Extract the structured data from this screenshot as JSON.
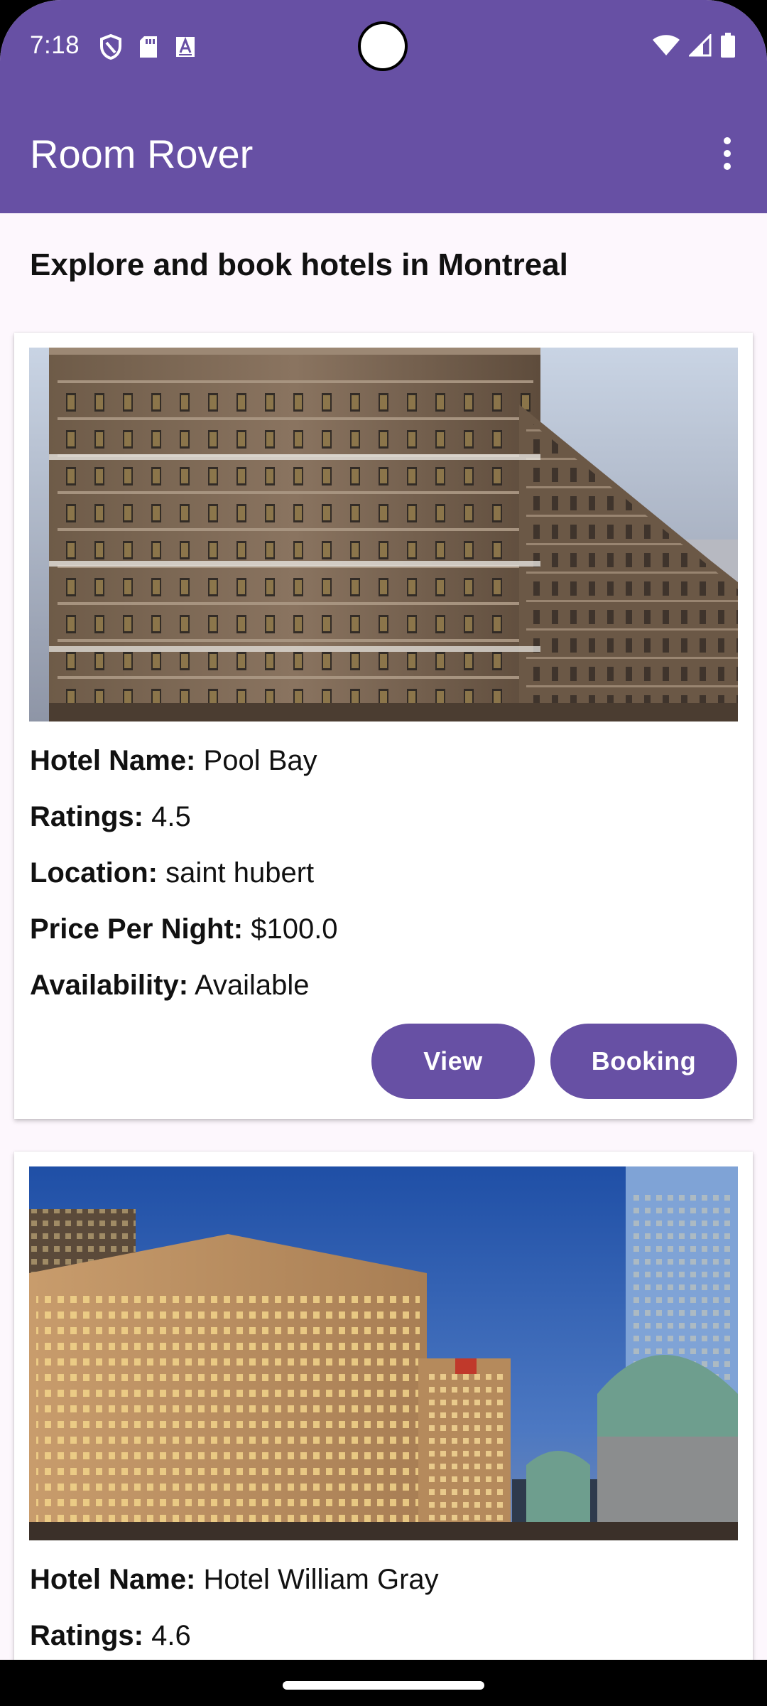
{
  "status_bar": {
    "time": "7:18",
    "left_icons": [
      "shield-icon",
      "sd-card-icon",
      "font-a-icon"
    ],
    "right_icons": [
      "wifi-icon",
      "cellular-icon",
      "battery-icon"
    ]
  },
  "app_bar": {
    "title": "Room Rover",
    "menu_icon": "more-vert-icon"
  },
  "page": {
    "heading": "Explore and book hotels in Montreal"
  },
  "hotels": [
    {
      "name_label": "Hotel Name:",
      "name": "Pool Bay",
      "rating_label": "Ratings:",
      "rating": "4.5",
      "location_label": "Location:",
      "location": "saint hubert",
      "price_label": "Price Per Night:",
      "price": "$100.0",
      "availability_label": "Availability:",
      "availability": "Available",
      "view_label": "View",
      "booking_label": "Booking"
    },
    {
      "name_label": "Hotel Name:",
      "name": "Hotel William Gray",
      "rating_label": "Ratings:",
      "rating": "4.6"
    }
  ],
  "colors": {
    "primary": "#6750A4",
    "background": "#FDF7FD",
    "card": "#FFFFFF"
  }
}
